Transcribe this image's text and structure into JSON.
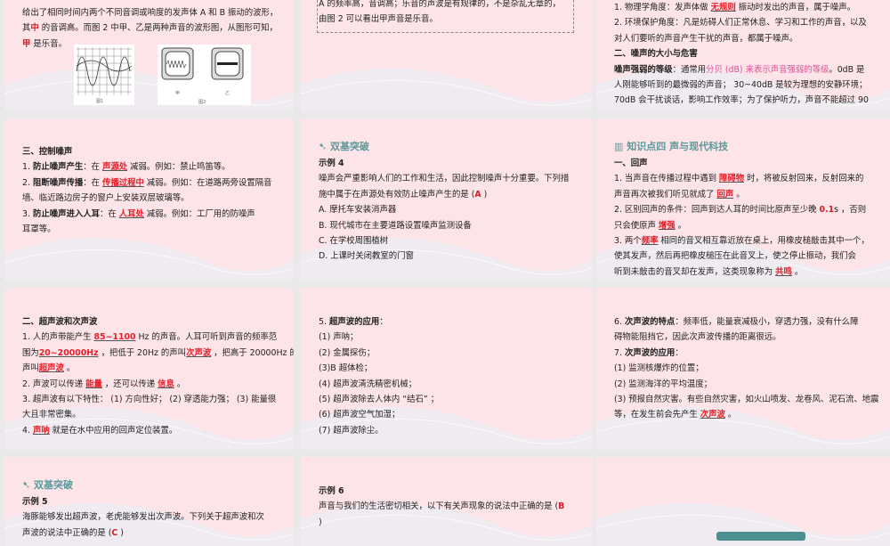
{
  "slides": [
    {
      "id": "s1",
      "lines": [
        [
          {
            "t": "给出了相同时间内两个不同音调或响度的发声体 A 和 B 振动的波形，"
          }
        ],
        [
          {
            "t": "其"
          },
          {
            "t": "中",
            "s": "ans"
          },
          {
            "t": "  的音调高。而图 2 中甲、乙是两种声音的波形图，从图形可知，"
          }
        ],
        [
          {
            "t": "甲",
            "s": "ans"
          },
          {
            "t": "  是乐音。"
          }
        ]
      ],
      "figures": {
        "fig1_caption": "图1",
        "fig2_caption": "图2",
        "fig2_left": "甲",
        "fig2_right": "乙",
        "label_a": "A",
        "label_b": "B"
      }
    },
    {
      "id": "s2",
      "lines": [
        [
          {
            "t": "A 的频率高，音调高；乐音的声波是有规律的，不是杂乱无章的，"
          }
        ],
        [
          {
            "t": "由图 2 可以看出甲声音是乐音。"
          }
        ]
      ]
    },
    {
      "id": "s3",
      "lines": [
        [
          {
            "t": "1. 物理学角度：发声体做 "
          },
          {
            "t": "无规则",
            "s": "red"
          },
          {
            "t": "   振动时发出的声音，属于噪声。"
          }
        ],
        [
          {
            "t": "2. 环境保护角度：凡是妨碍人们正常休息、学习和工作的声音，以及"
          }
        ],
        [
          {
            "t": "对人们要听的声音产生干扰的声音，都属于噪声。"
          }
        ],
        [
          {
            "t": "二、噪声的大小与危害",
            "s": "bold"
          }
        ],
        [
          {
            "t": "噪声强弱的等级",
            "s": "bold"
          },
          {
            "t": "：通常用"
          },
          {
            "t": "分贝 (dB) 来表示声音强弱的等级",
            "s": "pink"
          },
          {
            "t": "。0dB 是"
          }
        ],
        [
          {
            "t": "人刚能够听到的最微弱的声音； 30~40dB 是较为理想的安静环境；"
          }
        ],
        [
          {
            "t": "70dB 会干扰谈话，影响工作效率；为了保护听力，声音不能超过 90"
          }
        ]
      ]
    },
    {
      "id": "s4",
      "lines": [
        [
          {
            "t": "三、控制噪声",
            "s": "bold"
          }
        ],
        [
          {
            "t": "1. "
          },
          {
            "t": "防止噪声产生",
            "s": "bold"
          },
          {
            "t": "：在 "
          },
          {
            "t": "声源处",
            "s": "red"
          },
          {
            "t": "  减弱。例如：禁止鸣笛等。"
          }
        ],
        [
          {
            "t": "2. "
          },
          {
            "t": "阻断噪声传播",
            "s": "bold"
          },
          {
            "t": "：在 "
          },
          {
            "t": "传播过程中",
            "s": "red"
          },
          {
            "t": " 减弱。例如：在道路两旁设置隔音"
          }
        ],
        [
          {
            "t": "墙、临近路边房子的窗户上安装双层玻璃等。"
          }
        ],
        [
          {
            "t": "3. "
          },
          {
            "t": "防止噪声进入人耳",
            "s": "bold"
          },
          {
            "t": "：在 "
          },
          {
            "t": "人耳处",
            "s": "red"
          },
          {
            "t": "    减弱。例如：工厂用的防噪声"
          }
        ],
        [
          {
            "t": "耳罩等。"
          }
        ]
      ]
    },
    {
      "id": "s5",
      "section": "双基突破",
      "lines": [
        [
          {
            "t": "示例 4",
            "s": "bold"
          }
        ],
        [
          {
            "t": "噪声会严重影响人们的工作和生活，因此控制噪声十分重要。下列措"
          }
        ],
        [
          {
            "t": "施中属于在声源处有效防止噪声产生的是 ("
          },
          {
            "t": "A",
            "s": "ans"
          },
          {
            "t": " )"
          }
        ],
        [
          {
            "t": "A. 摩托车安装消声器"
          }
        ],
        [
          {
            "t": "B. 现代城市在主要道路设置噪声监测设备"
          }
        ],
        [
          {
            "t": "C. 在学校周围植树"
          }
        ],
        [
          {
            "t": "D. 上课时关闭教室的门窗"
          }
        ]
      ]
    },
    {
      "id": "s6",
      "section": "知识点四  声与现代科技",
      "lines": [
        [
          {
            "t": "一、回声",
            "s": "bold"
          }
        ],
        [
          {
            "t": "1. 当声音在传播过程中遇到 "
          },
          {
            "t": "障碍物",
            "s": "red"
          },
          {
            "t": " 时，将被反射回来，反射回来的"
          }
        ],
        [
          {
            "t": "声音再次被我们听见就成了  "
          },
          {
            "t": "回声",
            "s": "red"
          },
          {
            "t": "   。"
          }
        ],
        [
          {
            "t": "2. 区别回声的条件：回声到达人耳的时间比原声至少晚  "
          },
          {
            "t": "0.1",
            "s": "ans"
          },
          {
            "t": "s ，否则"
          }
        ],
        [
          {
            "t": "只会使原声  "
          },
          {
            "t": "增强",
            "s": "red"
          },
          {
            "t": " 。"
          }
        ],
        [
          {
            "t": "3. 两个"
          },
          {
            "t": "频率",
            "s": "red"
          },
          {
            "t": " 相同的音叉相互靠近放在桌上，用橡皮槌敲击其中一个，"
          }
        ],
        [
          {
            "t": "使其发声，然后再把橡皮槌压在此音叉上，使之停止振动，我们会"
          }
        ],
        [
          {
            "t": "听到未敲击的音叉却在发声，这类现象称为 "
          },
          {
            "t": "共鸣",
            "s": "red"
          },
          {
            "t": " 。"
          }
        ]
      ]
    },
    {
      "id": "s7",
      "lines": [
        [
          {
            "t": "二、超声波和次声波",
            "s": "bold"
          }
        ],
        [
          {
            "t": "1. 人的声带能产生  "
          },
          {
            "t": "85~1100",
            "s": "red"
          },
          {
            "t": "    Hz 的声音。人耳可听到声音的频率范"
          }
        ],
        [
          {
            "t": "围为"
          },
          {
            "t": "20~20000Hz",
            "s": "red"
          },
          {
            "t": "  ，把低于 20Hz 的声叫"
          },
          {
            "t": "次声波",
            "s": "red"
          },
          {
            "t": "    ，把高于 20000Hz 的"
          }
        ],
        [
          {
            "t": "声叫"
          },
          {
            "t": "超声波",
            "s": "red"
          },
          {
            "t": "  。"
          }
        ],
        [
          {
            "t": "2. 声波可以传递  "
          },
          {
            "t": "能量",
            "s": "red"
          },
          {
            "t": "    ，还可以传递 "
          },
          {
            "t": "信息",
            "s": "red"
          },
          {
            "t": "    。"
          }
        ],
        [
          {
            "t": "3. 超声波有以下特性： (1) 方向性好； (2) 穿透能力强； (3) 能量很"
          }
        ],
        [
          {
            "t": "大且非常密集。"
          }
        ],
        [
          {
            "t": "4.   "
          },
          {
            "t": "声呐",
            "s": "red"
          },
          {
            "t": "      就是在水中应用的回声定位装置。"
          }
        ]
      ]
    },
    {
      "id": "s8",
      "lines": [
        [
          {
            "t": "5. "
          },
          {
            "t": "超声波的应用",
            "s": "bold"
          },
          {
            "t": "："
          }
        ],
        [
          {
            "t": "(1) 声呐；"
          }
        ],
        [
          {
            "t": "(2) 金属探伤；"
          }
        ],
        [
          {
            "t": "(3)B 超体检；"
          }
        ],
        [
          {
            "t": "(4) 超声波清洗精密机械；"
          }
        ],
        [
          {
            "t": "(5) 超声波除去人体内 “结石” ；"
          }
        ],
        [
          {
            "t": "(6) 超声波空气加湿；"
          }
        ],
        [
          {
            "t": "(7) 超声波除尘。"
          }
        ]
      ]
    },
    {
      "id": "s9",
      "lines": [
        [
          {
            "t": "6. "
          },
          {
            "t": "次声波的特点",
            "s": "bold"
          },
          {
            "t": "：频率低，能量衰减极小，穿透力强，没有什么障"
          }
        ],
        [
          {
            "t": "碍物能阻挡它，因此次声波传播的距离很远。"
          }
        ],
        [
          {
            "t": "7. "
          },
          {
            "t": "次声波的应用",
            "s": "bold"
          },
          {
            "t": "："
          }
        ],
        [
          {
            "t": "(1) 监测核爆炸的位置；"
          }
        ],
        [
          {
            "t": "(2) 监测海洋的平均温度；"
          }
        ],
        [
          {
            "t": "(3) 预报自然灾害。有些自然灾害，如火山喷发、龙卷风、泥石流、地震"
          }
        ],
        [
          {
            "t": "等，在发生前会先产生 "
          },
          {
            "t": "次声波",
            "s": "red"
          },
          {
            "t": "  。"
          }
        ]
      ]
    },
    {
      "id": "s10",
      "section": "双基突破",
      "lines": [
        [
          {
            "t": "示例 5",
            "s": "bold"
          }
        ],
        [
          {
            "t": "海豚能够发出超声波，老虎能够发出次声波。下列关于超声波和次"
          }
        ],
        [
          {
            "t": "声波的说法中正确的是 ("
          },
          {
            "t": "C",
            "s": "ans"
          },
          {
            "t": " )"
          }
        ]
      ]
    },
    {
      "id": "s11",
      "lines": [
        [
          {
            "t": "示例 6",
            "s": "bold"
          }
        ],
        [
          {
            "t": "声音与我们的生活密切相关，以下有关声现象的说法中正确的是 ("
          },
          {
            "t": "B",
            "s": "ans"
          }
        ],
        [
          {
            "t": ")"
          }
        ]
      ]
    },
    {
      "id": "s12",
      "lines": []
    }
  ],
  "colors": {
    "slide_bg": "#fde4e8",
    "answer_red": "#e8202a",
    "section_teal": "#5a9a9a",
    "highlight_pink": "#e0509a"
  }
}
